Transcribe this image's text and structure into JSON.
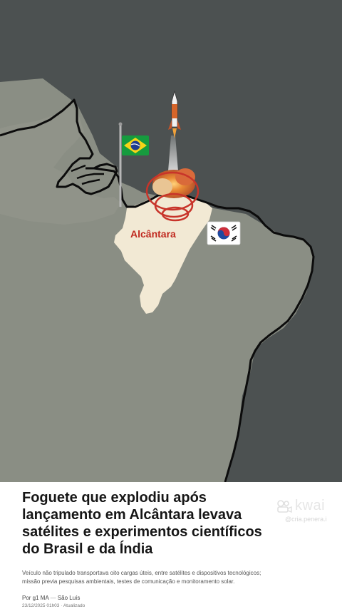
{
  "map": {
    "place_label": "Alcântara",
    "colors": {
      "background_top": "#4b5050",
      "land": "#8b8f85",
      "maranhao": "#f3ead6",
      "coast": "#0d0d0d",
      "highlight": "#c0291f"
    }
  },
  "flags": {
    "brazil": "brazil-flag",
    "south_korea": "south-korea-flag"
  },
  "article": {
    "headline": "Foguete que explodiu após lançamento em Alcântara levava satélites e experimentos científicos do Brasil e da Índia",
    "summary": "Veículo não tripulado transportava oito cargas úteis, entre satélites e dispositivos tecnológicos; missão previa pesquisas ambientais, testes de comunicação e monitoramento solar.",
    "author": "Por g1 MA",
    "separator": "—",
    "location": "São Luís",
    "date": "23/12/2025 01h03 · Atualizado"
  },
  "watermark": {
    "brand": "kwai",
    "handle": "@cria.penera.i"
  }
}
